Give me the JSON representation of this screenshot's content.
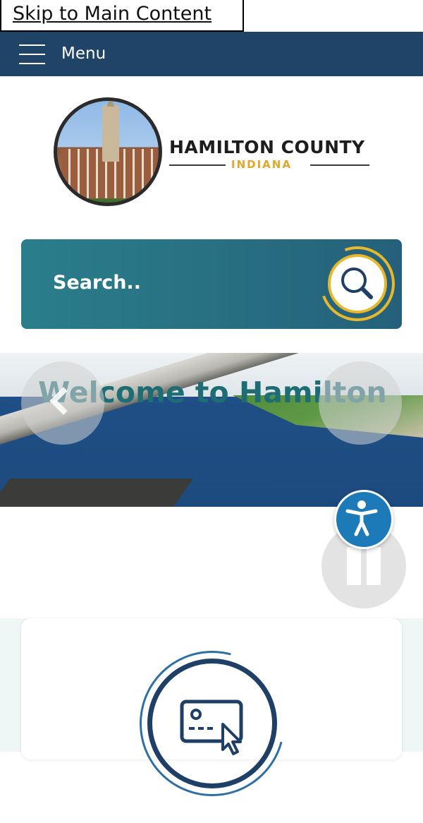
{
  "skip_link": {
    "label": "Skip to Main Content"
  },
  "header": {
    "menu_label": "Menu"
  },
  "logo": {
    "title": "HAMILTON COUNTY",
    "subtitle": "INDIANA"
  },
  "search": {
    "placeholder": "Search.."
  },
  "hero": {
    "heading": "Welcome to Hamilton"
  },
  "icons": {
    "menu": "hamburger-icon",
    "search": "magnifier-icon",
    "accessibility": "accessibility-person-icon",
    "pause": "pause-icon",
    "prev": "chevron-left-icon",
    "payment": "credit-card-click-icon"
  },
  "colors": {
    "header_bg": "#1f4468",
    "search_bg": "#276d80",
    "search_ring": "#e7b72c",
    "accessibility_bg": "#1c7ab8",
    "heading": "#1e6d74",
    "subtitle": "#e0a82b"
  }
}
